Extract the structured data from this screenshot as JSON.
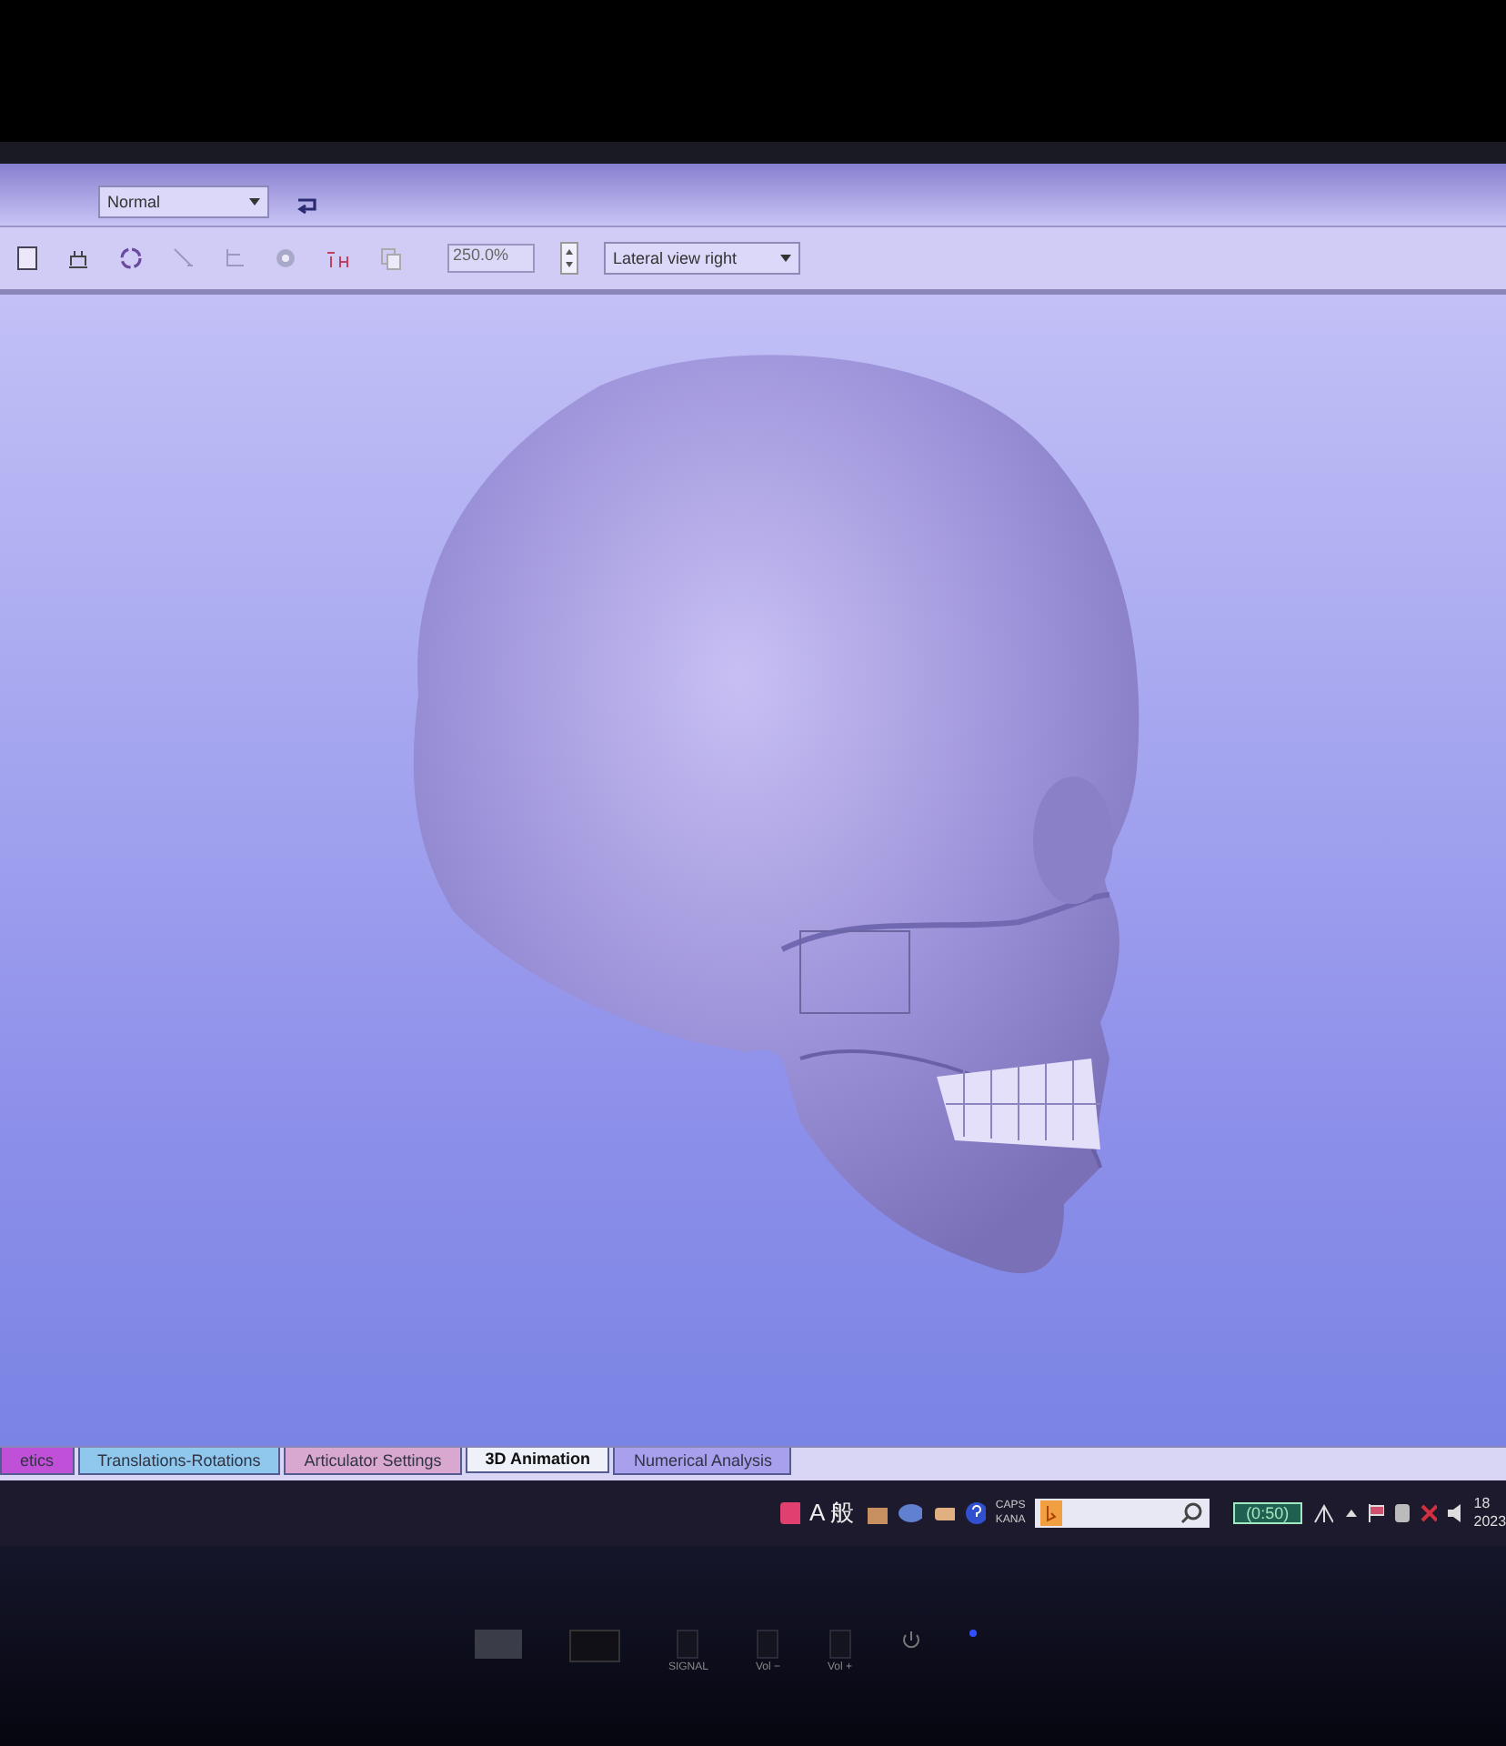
{
  "toolbar": {
    "style_select": "Normal",
    "zoom_field": "250.0%",
    "view_select": "Lateral view right"
  },
  "tabs": [
    {
      "label": "etics",
      "selected": false,
      "color": "#c050d8"
    },
    {
      "label": "Translations-Rotations",
      "selected": false,
      "color": "#8fc8ec"
    },
    {
      "label": "Articulator Settings",
      "selected": false,
      "color": "#d8a8d0"
    },
    {
      "label": "3D Animation",
      "selected": true,
      "color": "#eef0fa"
    },
    {
      "label": "Numerical Analysis",
      "selected": false,
      "color": "#a8a0ec"
    }
  ],
  "taskbar": {
    "ime_label": "A 般",
    "caps": "CAPS",
    "kana": "KANA",
    "battery": "(0:50)",
    "clock_time": "18",
    "clock_date": "2023"
  },
  "monitor": {
    "buttons": [
      "SIGNAL",
      "Vol −",
      "Vol +"
    ]
  }
}
